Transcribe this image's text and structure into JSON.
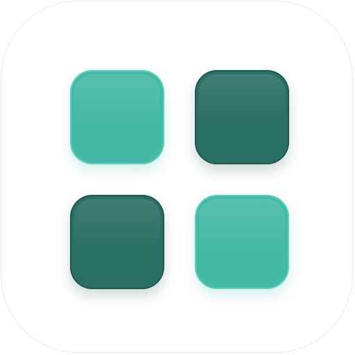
{
  "icon": {
    "semantic": "grid-apps-icon",
    "colors": {
      "background": "#ffffff",
      "border": "#e9ecea",
      "light_tile": "#44b9a6",
      "dark_tile": "#2a6f64"
    },
    "tiles": [
      {
        "name": "tile-top-left",
        "tone": "light"
      },
      {
        "name": "tile-top-right",
        "tone": "dark"
      },
      {
        "name": "tile-bottom-left",
        "tone": "dark"
      },
      {
        "name": "tile-bottom-right",
        "tone": "light"
      }
    ]
  }
}
